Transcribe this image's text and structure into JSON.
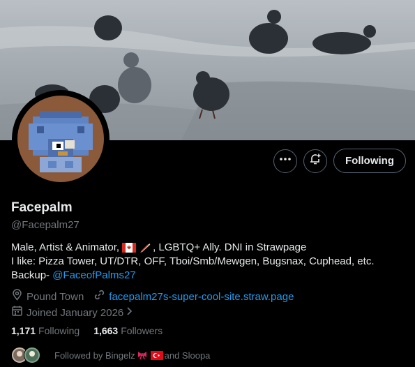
{
  "profile": {
    "display_name": "Facepalm",
    "handle": "@Facepalm27",
    "bio_line1_a": "Male, Artist & Animator,",
    "bio_line1_b": ", LGBTQ+ Ally. DNI in Strawpage",
    "bio_line2": "I like: Pizza Tower, UT/DTR, OFF, Tboi/Smb/Mewgen, Bugsnax, Cuphead, etc.",
    "bio_line3_prefix": "Backup-",
    "bio_line3_link": "@FaceofPalms27",
    "location": "Pound Town",
    "website": "facepalm27s-super-cool-site.straw.page",
    "joined": "Joined January 2026",
    "following_count": "1,171",
    "following_label": "Following",
    "followers_count": "1,663",
    "followers_label": "Followers",
    "followed_by_prefix": "Followed by Bingelz",
    "followed_by_suffix": "and Sloopa"
  },
  "actions": {
    "more_icon": "more-icon",
    "notify_icon": "bell-plus-icon",
    "follow_label": "Following"
  },
  "colors": {
    "link": "#1d9bf0",
    "muted": "#71767b",
    "text": "#e7e9ea",
    "background": "#000000"
  }
}
